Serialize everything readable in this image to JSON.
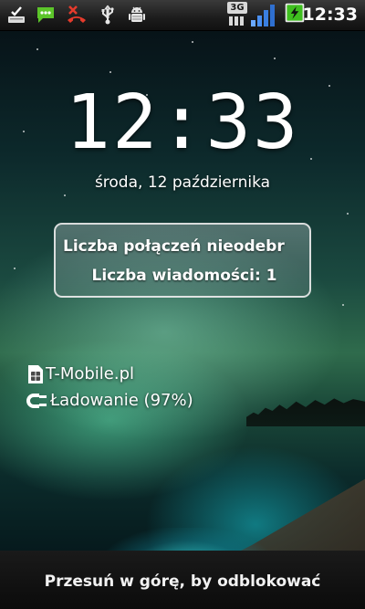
{
  "status_bar": {
    "network_type": "3G",
    "time": "12:33",
    "icons": [
      "done-checklist-icon",
      "sms-message-icon",
      "missed-call-icon",
      "usb-icon",
      "android-debug-icon",
      "signal-strength-icon",
      "battery-charging-icon"
    ],
    "accent_color": "#3fbf1f"
  },
  "lockscreen": {
    "clock": "12:33",
    "date": "środa, 12 października",
    "notifications": {
      "line1": "Liczba połączeń nieodebr",
      "line2": "Liczba wiadomości: 1"
    },
    "carrier": "T-Mobile.pl",
    "charging": "Ładowanie (97%)",
    "unlock_hint": "Przesuń w górę, by odblokować"
  }
}
